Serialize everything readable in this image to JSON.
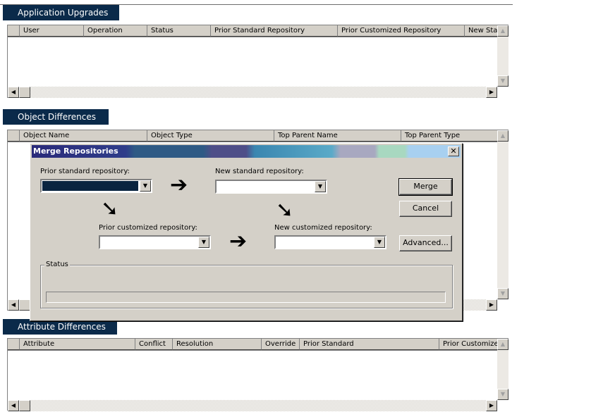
{
  "app_upgrades": {
    "title": "Application Upgrades",
    "columns": [
      "User",
      "Operation",
      "Status",
      "Prior Standard Repository",
      "Prior Customized Repository",
      "New Sta"
    ]
  },
  "object_diffs": {
    "title": "Object Differences",
    "columns": [
      "Object Name",
      "Object Type",
      "Top Parent Name",
      "Top Parent Type"
    ]
  },
  "attribute_diffs": {
    "title": "Attribute Differences",
    "columns": [
      "Attribute",
      "Conflict",
      "Resolution",
      "Override",
      "Prior Standard",
      "Prior Customized"
    ]
  },
  "dialog": {
    "title": "Merge Repositories",
    "close_glyph": "✕",
    "prior_standard_label": "Prior standard repository:",
    "new_standard_label": "New standard repository:",
    "prior_customized_label": "Prior customized repository:",
    "new_customized_label": "New customized repository:",
    "merge_label": "Merge",
    "cancel_label": "Cancel",
    "advanced_label": "Advanced...",
    "status_label": "Status",
    "progress": 0
  },
  "icons": {
    "arrow_right": "➔",
    "arrow_down_right": "➘",
    "scroll_up": "▲",
    "scroll_down": "▼",
    "scroll_left": "◀",
    "scroll_right": "▶",
    "dropdown": "▼"
  }
}
